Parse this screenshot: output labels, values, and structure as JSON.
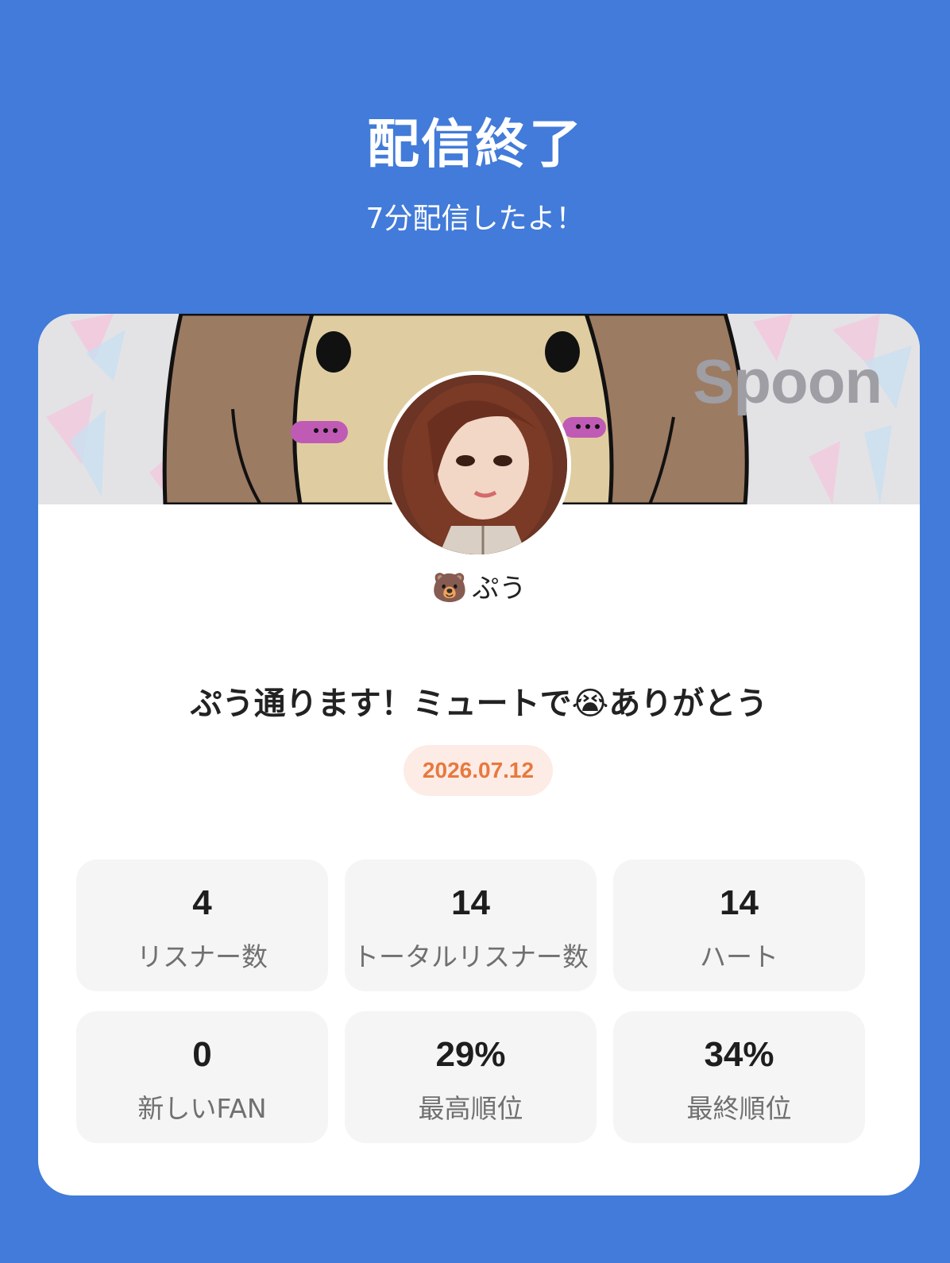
{
  "header": {
    "title": "配信終了",
    "subtitle": "7分配信したよ！"
  },
  "card": {
    "brand": "Spoon",
    "username_emoji": "🐻",
    "username": "ぷう",
    "stream_title": "ぷう通ります！ミュートで😭ありがとう",
    "date": "2026.07.12",
    "stats": [
      {
        "value": "4",
        "label": "リスナー数"
      },
      {
        "value": "14",
        "label": "トータルリスナー数"
      },
      {
        "value": "14",
        "label": "ハート"
      },
      {
        "value": "0",
        "label": "新しいFAN"
      },
      {
        "value": "29%",
        "label": "最高順位"
      },
      {
        "value": "34%",
        "label": "最終順位"
      }
    ]
  },
  "colors": {
    "background": "#427bd9",
    "card": "#ffffff",
    "date_badge_bg": "#fdebe5",
    "date_badge_text": "#e7793e",
    "stat_tile": "#f5f5f5"
  },
  "icons": {
    "banner": "cartoon-character-banner",
    "avatar": "profile-avatar-image"
  }
}
